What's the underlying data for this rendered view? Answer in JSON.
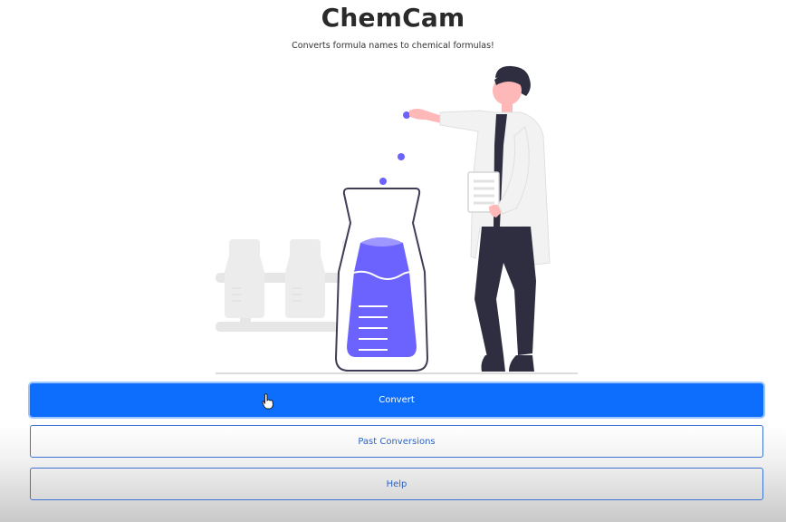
{
  "app": {
    "title": "ChemCam",
    "subtitle": "Converts formula names to chemical formulas!"
  },
  "illustration": {
    "icon": "scientist-with-flask-illustration",
    "accent_color": "#6c63ff"
  },
  "actions": {
    "convert_label": "Convert",
    "past_conversions_label": "Past Conversions",
    "help_label": "Help"
  },
  "colors": {
    "primary": "#0d6efd",
    "outline": "#3f73d1"
  }
}
